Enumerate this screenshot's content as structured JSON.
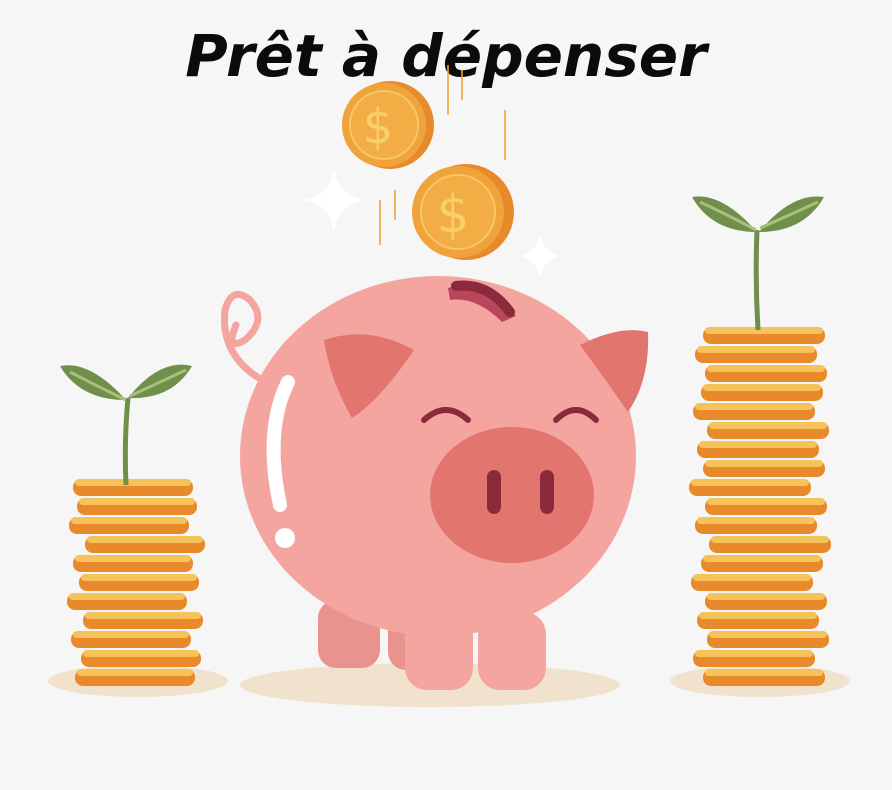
{
  "title": "Prêt à dépenser",
  "colors": {
    "background": "#f6f6f6",
    "coin_fill": "#f0a33a",
    "coin_edge": "#e88a2c",
    "coin_top": "#f5c35a",
    "pig_body": "#f4a5a0",
    "pig_dark": "#e3756f",
    "slot": "#8b2a3a",
    "leaf": "#6f8f4a",
    "shadow": "#f0e2cc"
  },
  "icons": [
    "dollar-coin-icon",
    "piggy-bank-icon",
    "coin-stack-icon",
    "sprout-icon",
    "sparkle-icon"
  ],
  "coin_symbol": "$"
}
